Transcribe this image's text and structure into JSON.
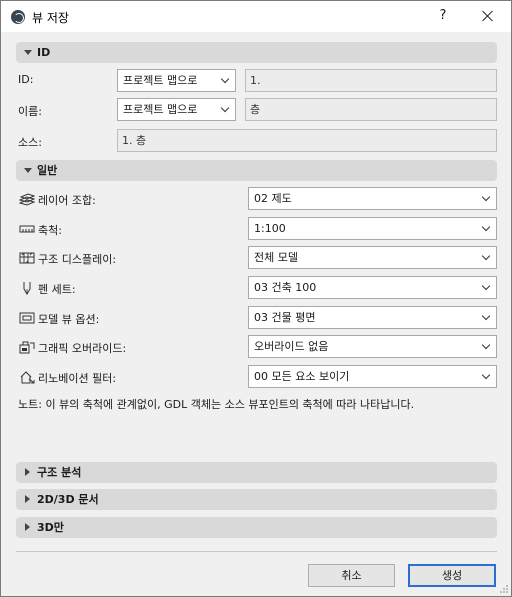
{
  "window": {
    "title": "뷰 저장",
    "help_label": "?",
    "icons": {
      "app": "archicad-logo-icon",
      "close": "close-icon"
    }
  },
  "sections": {
    "id": {
      "title": "ID",
      "expanded": true
    },
    "general": {
      "title": "일반",
      "expanded": true
    },
    "structural": {
      "title": "구조 분석",
      "expanded": false
    },
    "documents": {
      "title": "2D/3D 문서",
      "expanded": false
    },
    "only3d": {
      "title": "3D만",
      "expanded": false
    }
  },
  "id_section": {
    "id_label": "ID:",
    "id_source": "프로젝트 맵으로",
    "id_value": "1.",
    "name_label": "이름:",
    "name_source": "프로젝트 맵으로",
    "name_value": "층",
    "source_label": "소스:",
    "source_value": "1. 층"
  },
  "general": {
    "rows": [
      {
        "label": "레이어 조합:",
        "value": "02 제도",
        "icon": "layers-icon"
      },
      {
        "label": "축척:",
        "value": "1:100",
        "icon": "scale-ruler-icon"
      },
      {
        "label": "구조 디스플레이:",
        "value": "전체 모델",
        "icon": "structure-display-icon"
      },
      {
        "label": "펜 세트:",
        "value": "03 건축 100",
        "icon": "pen-set-icon"
      },
      {
        "label": "모델 뷰 옵션:",
        "value": "03 건물 평면",
        "icon": "model-view-icon"
      },
      {
        "label": "그래픽 오버라이드:",
        "value": "오버라이드 없음",
        "icon": "graphic-override-icon"
      },
      {
        "label": "리노베이션 필터:",
        "value": "00 모든 요소 보이기",
        "icon": "renovation-filter-icon"
      }
    ],
    "note": "노트: 이 뷰의 축척에 관계없이, GDL 객체는 소스 뷰포인트의 축척에 따라 나타납니다."
  },
  "buttons": {
    "cancel": "취소",
    "create": "생성"
  },
  "colors": {
    "accent": "#2b6fd0",
    "section_bg": "#d9d9d9",
    "dialog_bg": "#f0f0f0"
  }
}
